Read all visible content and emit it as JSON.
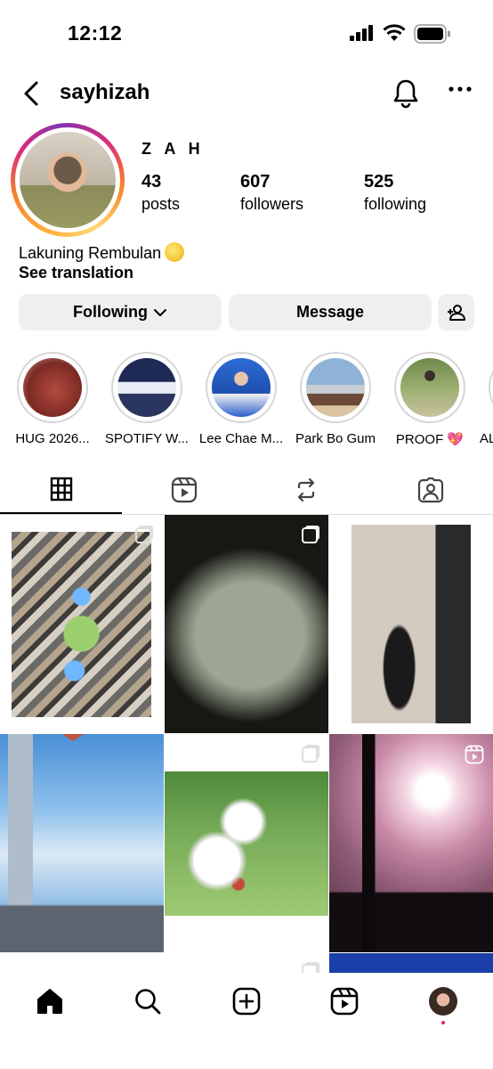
{
  "status_bar": {
    "time": "12:12"
  },
  "header": {
    "username": "sayhizah"
  },
  "profile": {
    "display_name": "Z A H",
    "stats": [
      {
        "value": "43",
        "label": "posts"
      },
      {
        "value": "607",
        "label": "followers"
      },
      {
        "value": "525",
        "label": "following"
      }
    ],
    "bio": "Lakuning Rembulan",
    "see_translation": "See translation"
  },
  "actions": {
    "following": "Following",
    "message": "Message"
  },
  "highlights": [
    {
      "label": "HUG 2026..."
    },
    {
      "label": "SPOTIFY W..."
    },
    {
      "label": "Lee Chae M..."
    },
    {
      "label": "Park Bo Gum"
    },
    {
      "label": "PROOF 💖"
    },
    {
      "label": "AL"
    }
  ],
  "tabs": [
    "grid",
    "reels",
    "reposts",
    "tagged"
  ],
  "colors": {
    "story_ring": "#dd2a7b",
    "button_bg": "#efefef",
    "notification_dot": "#e0245e"
  },
  "icons": [
    "back-icon",
    "bell-icon",
    "more-icon",
    "chevron-down-icon",
    "add-person-icon",
    "grid-icon",
    "reels-icon",
    "repost-icon",
    "tagged-icon",
    "home-icon",
    "search-icon",
    "create-icon",
    "reels-nav-icon"
  ]
}
